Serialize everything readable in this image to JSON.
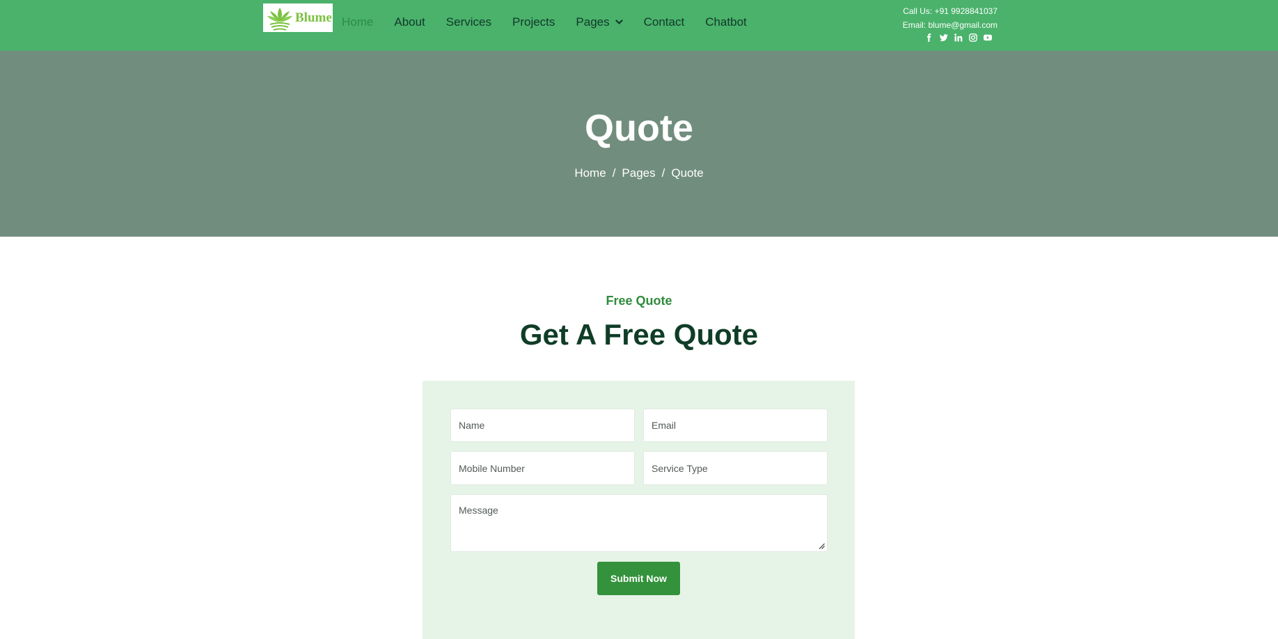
{
  "navbar": {
    "logo_text": "Blume",
    "items": [
      {
        "label": "Home",
        "active": true
      },
      {
        "label": "About"
      },
      {
        "label": "Services"
      },
      {
        "label": "Projects"
      },
      {
        "label": "Pages",
        "has_dropdown": true
      },
      {
        "label": "Contact"
      },
      {
        "label": "Chatbot"
      }
    ],
    "call": "Call Us: +91 9928841037",
    "email": "Email: blume@gmail.com",
    "socials": [
      "facebook-icon",
      "twitter-icon",
      "linkedin-icon",
      "instagram-icon",
      "youtube-icon"
    ]
  },
  "hero": {
    "title": "Quote",
    "breadcrumb": [
      "Home",
      "Pages",
      "Quote"
    ],
    "separator": "/"
  },
  "section": {
    "eyebrow": "Free Quote",
    "title": "Get A Free Quote"
  },
  "form": {
    "name_placeholder": "Name",
    "email_placeholder": "Email",
    "mobile_placeholder": "Mobile Number",
    "service_placeholder": "Service Type",
    "message_placeholder": "Message",
    "submit_label": "Submit Now"
  },
  "colors": {
    "navbar_bg": "#4ab26b",
    "hero_bg": "#718d7e",
    "accent": "#33923b",
    "title": "#0f3d27",
    "form_bg": "#e6f4e7"
  }
}
